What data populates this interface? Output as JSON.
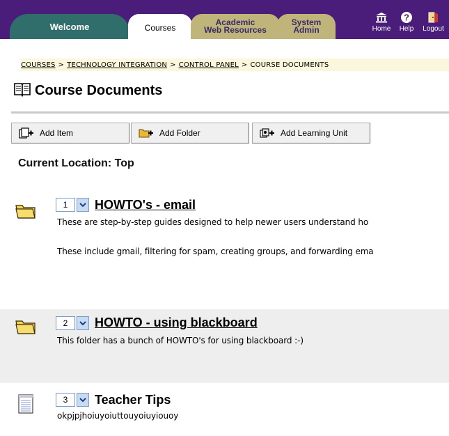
{
  "tabs": {
    "welcome": "Welcome",
    "courses": "Courses",
    "academic_line1": "Academic",
    "academic_line2": "Web Resources",
    "admin_line1": "System",
    "admin_line2": "Admin"
  },
  "top_icons": {
    "home": "Home",
    "help": "Help",
    "logout": "Logout"
  },
  "breadcrumb": {
    "items": [
      "COURSES",
      "TECHNOLOGY INTEGRATION",
      "CONTROL PANEL"
    ],
    "current": "COURSE DOCUMENTS",
    "separator": ">"
  },
  "page": {
    "title": "Course Documents",
    "icon": "book-icon"
  },
  "actions": {
    "add_item": "Add Item",
    "add_folder": "Add Folder",
    "add_learning_unit": "Add Learning Unit"
  },
  "current_location": "Current Location: Top",
  "items": [
    {
      "order": "1",
      "icon": "folder-icon",
      "title": "HOWTO's - email",
      "desc1": "These are step-by-step guides designed to help newer users understand ho",
      "desc2": "These include gmail, filtering for spam, creating groups, and forwarding ema"
    },
    {
      "order": "2",
      "icon": "folder-icon",
      "title": "HOWTO - using blackboard",
      "desc1": "This folder has a bunch of HOWTO's for using blackboard :-)"
    },
    {
      "order": "3",
      "icon": "document-icon",
      "title": "Teacher Tips",
      "desc1": "okpjpjhoiuyoiuttouyoiuyiouoy"
    }
  ],
  "colors": {
    "topbar": "#4b1d7a",
    "welcome_tab": "#2f6e6a",
    "resource_tab": "#bfb57a",
    "breadcrumb_bg": "#fbf7dc",
    "alt_row": "#eeeeee"
  }
}
